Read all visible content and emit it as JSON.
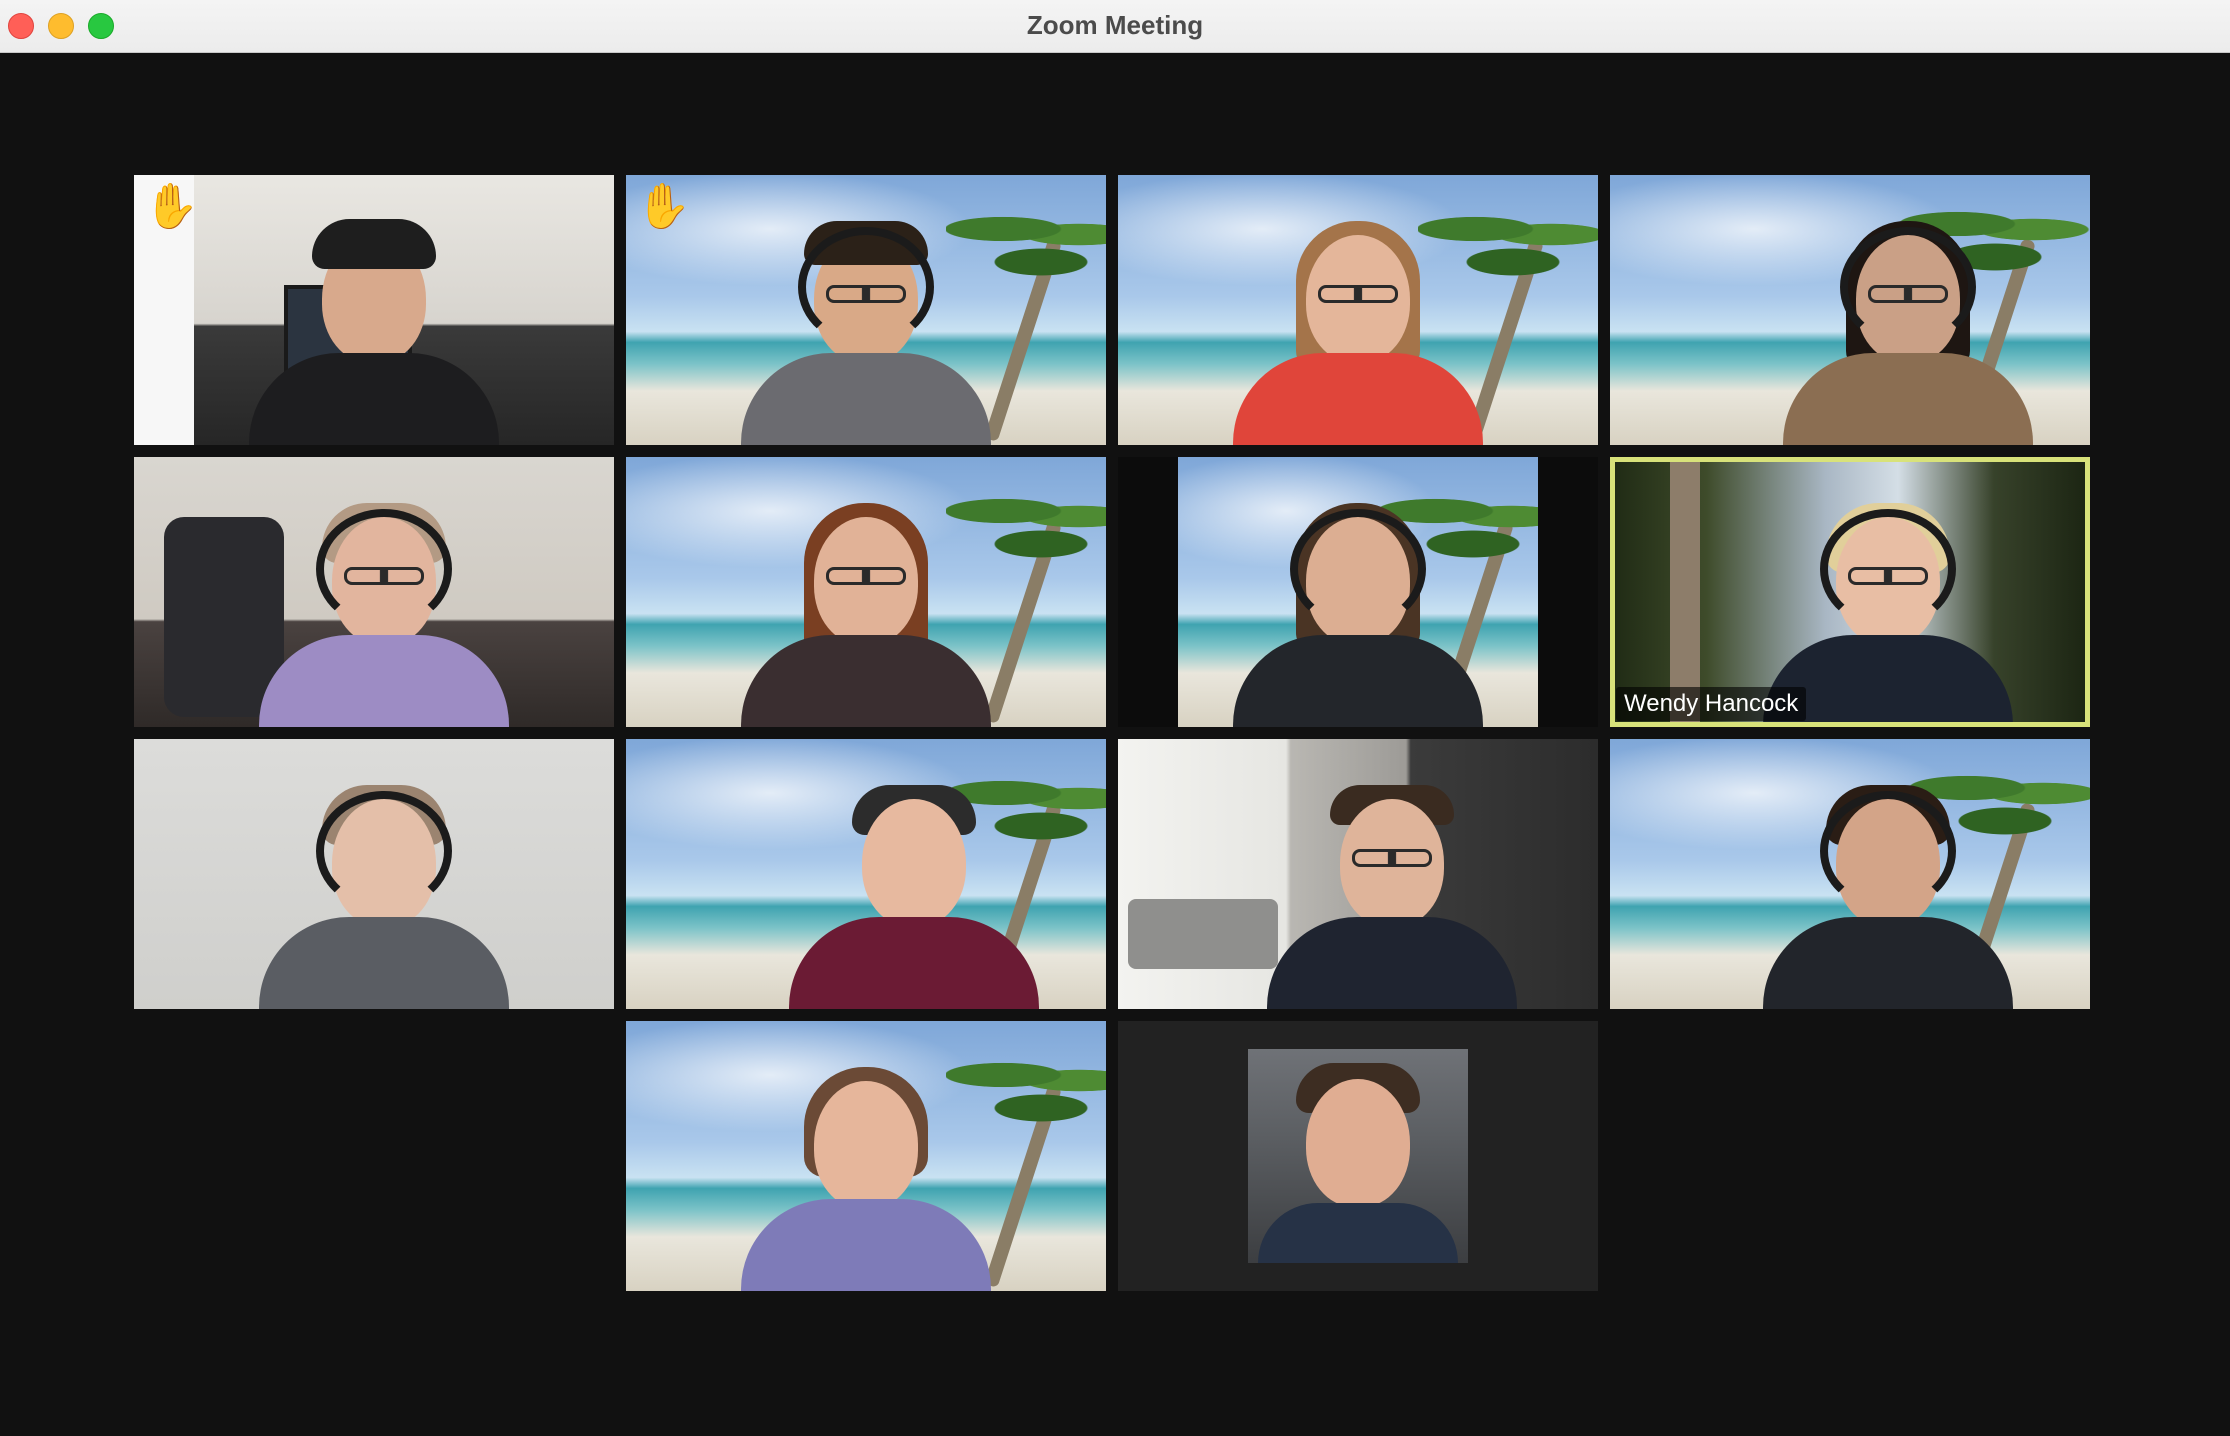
{
  "window": {
    "title": "Zoom Meeting",
    "controls": [
      "close",
      "minimize",
      "maximize"
    ]
  },
  "colors": {
    "active_speaker_border": "#d8e27a",
    "raised_hand": "#f0b43a",
    "stage_background": "#111111"
  },
  "gallery": {
    "tiles": [
      {
        "id": 1,
        "scene": "home office with monitors",
        "raised_hand": true,
        "label": ""
      },
      {
        "id": 2,
        "scene": "beach virtual background",
        "raised_hand": true,
        "label": ""
      },
      {
        "id": 3,
        "scene": "beach virtual background",
        "raised_hand": false,
        "label": ""
      },
      {
        "id": 4,
        "scene": "beach virtual background",
        "raised_hand": false,
        "label": ""
      },
      {
        "id": 5,
        "scene": "bedroom with gaming chair",
        "raised_hand": false,
        "label": ""
      },
      {
        "id": 6,
        "scene": "beach virtual background",
        "raised_hand": false,
        "label": ""
      },
      {
        "id": 7,
        "scene": "beach virtual background",
        "raised_hand": false,
        "label": ""
      },
      {
        "id": 8,
        "scene": "forest lake",
        "raised_hand": false,
        "label": "Wendy Hancock",
        "active_speaker": true
      },
      {
        "id": 9,
        "scene": "plain wall",
        "raised_hand": false,
        "label": ""
      },
      {
        "id": 10,
        "scene": "beach virtual background",
        "raised_hand": false,
        "label": ""
      },
      {
        "id": 11,
        "scene": "apartment living room",
        "raised_hand": false,
        "label": ""
      },
      {
        "id": 12,
        "scene": "beach virtual background",
        "raised_hand": false,
        "label": ""
      },
      {
        "id": 13,
        "scene": "beach virtual background",
        "raised_hand": false,
        "label": ""
      },
      {
        "id": 14,
        "scene": "profile photo, camera off",
        "raised_hand": false,
        "label": ""
      }
    ],
    "raised_hand_icon": "raised-hand-icon"
  }
}
